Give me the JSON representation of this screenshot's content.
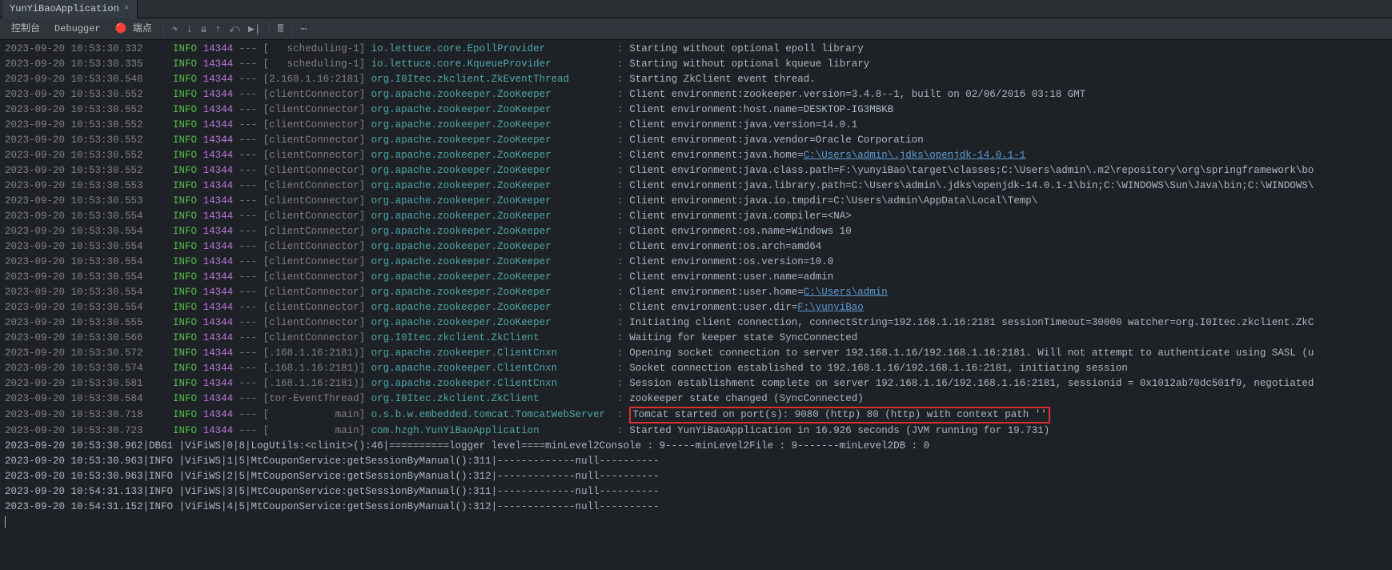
{
  "tab": {
    "title": "YunYiBaoApplication"
  },
  "toolbar": {
    "console": "控制台",
    "debugger": "Debugger",
    "breakpoints": "端点"
  },
  "cols": {
    "ts_pad": 26,
    "lvl_pad": 6,
    "pid_pad": 6,
    "thr_pad": 18,
    "logger_pad": 41
  },
  "logs": [
    {
      "t": "2023-09-20 10:53:30.332",
      "l": "INFO",
      "p": "14344",
      "th": "scheduling-1",
      "lg": "io.lettuce.core.EpollProvider",
      "m": "Starting without optional epoll library"
    },
    {
      "t": "2023-09-20 10:53:30.335",
      "l": "INFO",
      "p": "14344",
      "th": "scheduling-1",
      "lg": "io.lettuce.core.KqueueProvider",
      "m": "Starting without optional kqueue library"
    },
    {
      "t": "2023-09-20 10:53:30.548",
      "l": "INFO",
      "p": "14344",
      "th": "2.168.1.16:2181",
      "lg": "org.I0Itec.zkclient.ZkEventThread",
      "m": "Starting ZkClient event thread."
    },
    {
      "t": "2023-09-20 10:53:30.552",
      "l": "INFO",
      "p": "14344",
      "th": "clientConnector",
      "lg": "org.apache.zookeeper.ZooKeeper",
      "m": "Client environment:zookeeper.version=3.4.8--1, built on 02/06/2016 03:18 GMT"
    },
    {
      "t": "2023-09-20 10:53:30.552",
      "l": "INFO",
      "p": "14344",
      "th": "clientConnector",
      "lg": "org.apache.zookeeper.ZooKeeper",
      "m": "Client environment:host.name=DESKTOP-IG3MBKB"
    },
    {
      "t": "2023-09-20 10:53:30.552",
      "l": "INFO",
      "p": "14344",
      "th": "clientConnector",
      "lg": "org.apache.zookeeper.ZooKeeper",
      "m": "Client environment:java.version=14.0.1"
    },
    {
      "t": "2023-09-20 10:53:30.552",
      "l": "INFO",
      "p": "14344",
      "th": "clientConnector",
      "lg": "org.apache.zookeeper.ZooKeeper",
      "m": "Client environment:java.vendor=Oracle Corporation"
    },
    {
      "t": "2023-09-20 10:53:30.552",
      "l": "INFO",
      "p": "14344",
      "th": "clientConnector",
      "lg": "org.apache.zookeeper.ZooKeeper",
      "m_pre": "Client environment:java.home=",
      "link": "C:\\Users\\admin\\.jdks\\openjdk-14.0.1-1"
    },
    {
      "t": "2023-09-20 10:53:30.552",
      "l": "INFO",
      "p": "14344",
      "th": "clientConnector",
      "lg": "org.apache.zookeeper.ZooKeeper",
      "m": "Client environment:java.class.path=F:\\yunyiBao\\target\\classes;C:\\Users\\admin\\.m2\\repository\\org\\springframework\\bo"
    },
    {
      "t": "2023-09-20 10:53:30.553",
      "l": "INFO",
      "p": "14344",
      "th": "clientConnector",
      "lg": "org.apache.zookeeper.ZooKeeper",
      "m": "Client environment:java.library.path=C:\\Users\\admin\\.jdks\\openjdk-14.0.1-1\\bin;C:\\WINDOWS\\Sun\\Java\\bin;C:\\WINDOWS\\"
    },
    {
      "t": "2023-09-20 10:53:30.553",
      "l": "INFO",
      "p": "14344",
      "th": "clientConnector",
      "lg": "org.apache.zookeeper.ZooKeeper",
      "m": "Client environment:java.io.tmpdir=C:\\Users\\admin\\AppData\\Local\\Temp\\"
    },
    {
      "t": "2023-09-20 10:53:30.554",
      "l": "INFO",
      "p": "14344",
      "th": "clientConnector",
      "lg": "org.apache.zookeeper.ZooKeeper",
      "m": "Client environment:java.compiler=<NA>"
    },
    {
      "t": "2023-09-20 10:53:30.554",
      "l": "INFO",
      "p": "14344",
      "th": "clientConnector",
      "lg": "org.apache.zookeeper.ZooKeeper",
      "m": "Client environment:os.name=Windows 10"
    },
    {
      "t": "2023-09-20 10:53:30.554",
      "l": "INFO",
      "p": "14344",
      "th": "clientConnector",
      "lg": "org.apache.zookeeper.ZooKeeper",
      "m": "Client environment:os.arch=amd64"
    },
    {
      "t": "2023-09-20 10:53:30.554",
      "l": "INFO",
      "p": "14344",
      "th": "clientConnector",
      "lg": "org.apache.zookeeper.ZooKeeper",
      "m": "Client environment:os.version=10.0"
    },
    {
      "t": "2023-09-20 10:53:30.554",
      "l": "INFO",
      "p": "14344",
      "th": "clientConnector",
      "lg": "org.apache.zookeeper.ZooKeeper",
      "m": "Client environment:user.name=admin"
    },
    {
      "t": "2023-09-20 10:53:30.554",
      "l": "INFO",
      "p": "14344",
      "th": "clientConnector",
      "lg": "org.apache.zookeeper.ZooKeeper",
      "m_pre": "Client environment:user.home=",
      "link": "C:\\Users\\admin"
    },
    {
      "t": "2023-09-20 10:53:30.554",
      "l": "INFO",
      "p": "14344",
      "th": "clientConnector",
      "lg": "org.apache.zookeeper.ZooKeeper",
      "m_pre": "Client environment:user.dir=",
      "link": "F:\\yunyiBao"
    },
    {
      "t": "2023-09-20 10:53:30.555",
      "l": "INFO",
      "p": "14344",
      "th": "clientConnector",
      "lg": "org.apache.zookeeper.ZooKeeper",
      "m": "Initiating client connection, connectString=192.168.1.16:2181 sessionTimeout=30000 watcher=org.I0Itec.zkclient.ZkC"
    },
    {
      "t": "2023-09-20 10:53:30.566",
      "l": "INFO",
      "p": "14344",
      "th": "clientConnector",
      "lg": "org.I0Itec.zkclient.ZkClient",
      "m": "Waiting for keeper state SyncConnected"
    },
    {
      "t": "2023-09-20 10:53:30.572",
      "l": "INFO",
      "p": "14344",
      "th": ".168.1.16:2181)",
      "lg": "org.apache.zookeeper.ClientCnxn",
      "m": "Opening socket connection to server 192.168.1.16/192.168.1.16:2181. Will not attempt to authenticate using SASL (u"
    },
    {
      "t": "2023-09-20 10:53:30.574",
      "l": "INFO",
      "p": "14344",
      "th": ".168.1.16:2181)",
      "lg": "org.apache.zookeeper.ClientCnxn",
      "m": "Socket connection established to 192.168.1.16/192.168.1.16:2181, initiating session"
    },
    {
      "t": "2023-09-20 10:53:30.581",
      "l": "INFO",
      "p": "14344",
      "th": ".168.1.16:2181)",
      "lg": "org.apache.zookeeper.ClientCnxn",
      "m": "Session establishment complete on server 192.168.1.16/192.168.1.16:2181, sessionid = 0x1012ab70dc501f9, negotiated"
    },
    {
      "t": "2023-09-20 10:53:30.584",
      "l": "INFO",
      "p": "14344",
      "th": "tor-EventThread",
      "lg": "org.I0Itec.zkclient.ZkClient",
      "m": "zookeeper state changed (SyncConnected)",
      "hl_top": true
    },
    {
      "t": "2023-09-20 10:53:30.718",
      "l": "INFO",
      "p": "14344",
      "th": "main",
      "lg": "o.s.b.w.embedded.tomcat.TomcatWebServer",
      "m": "Tomcat started on port(s): 9080 (http) 80 (http) with context path ''",
      "hl": true
    },
    {
      "t": "2023-09-20 10:53:30.723",
      "l": "INFO",
      "p": "14344",
      "th": "main",
      "lg": "com.hzgh.YunYiBaoApplication",
      "m": "Started YunYiBaoApplication in 16.926 seconds (JVM running for 19.731)"
    }
  ],
  "plain_logs": [
    "2023-09-20 10:53:30.962|DBG1 |ViFiWS|0|8|LogUtils:<clinit>():46|==========logger level====minLevel2Console : 9-----minLevel2File : 9-------minLevel2DB : 0",
    "2023-09-20 10:53:30.963|INFO |ViFiWS|1|5|MtCouponService:getSessionByManual():311|-------------null----------",
    "2023-09-20 10:53:30.963|INFO |ViFiWS|2|5|MtCouponService:getSessionByManual():312|-------------null----------",
    "2023-09-20 10:54:31.133|INFO |ViFiWS|3|5|MtCouponService:getSessionByManual():311|-------------null----------",
    "2023-09-20 10:54:31.152|INFO |ViFiWS|4|5|MtCouponService:getSessionByManual():312|-------------null----------"
  ]
}
